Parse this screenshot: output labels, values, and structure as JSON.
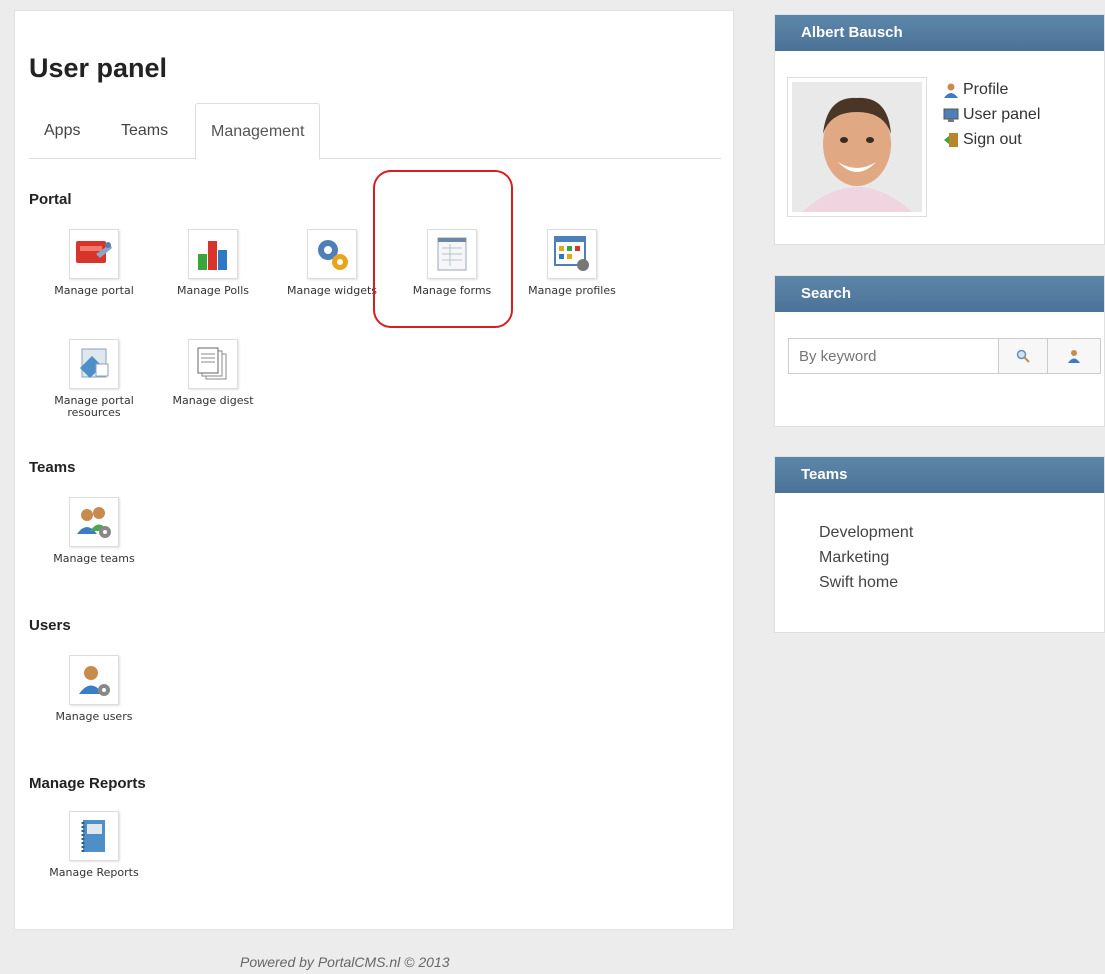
{
  "page": {
    "title": "User panel",
    "footer": "Powered by PortalCMS.nl © 2013"
  },
  "tabs": [
    {
      "label": "Apps",
      "active": false
    },
    {
      "label": "Teams",
      "active": false
    },
    {
      "label": "Management",
      "active": true
    }
  ],
  "sections": {
    "portal": {
      "title": "Portal",
      "tiles": [
        {
          "label": "Manage portal",
          "icon": "portal-tools-icon"
        },
        {
          "label": "Manage Polls",
          "icon": "bar-chart-icon"
        },
        {
          "label": "Manage widgets",
          "icon": "gear-widgets-icon"
        },
        {
          "label": "Manage forms",
          "icon": "form-icon"
        },
        {
          "label": "Manage profiles",
          "icon": "profile-grid-icon"
        },
        {
          "label": "Manage portal resources",
          "icon": "resources-icon"
        },
        {
          "label": "Manage digest",
          "icon": "digest-icon"
        }
      ]
    },
    "teams": {
      "title": "Teams",
      "tiles": [
        {
          "label": "Manage teams",
          "icon": "team-gear-icon"
        }
      ]
    },
    "users": {
      "title": "Users",
      "tiles": [
        {
          "label": "Manage users",
          "icon": "user-gear-icon"
        }
      ]
    },
    "reports": {
      "title": "Manage Reports",
      "tiles": [
        {
          "label": "Manage Reports",
          "icon": "report-book-icon"
        }
      ]
    }
  },
  "profile": {
    "name": "Albert Bausch",
    "links": [
      {
        "label": "Profile",
        "icon": "user-icon"
      },
      {
        "label": "User panel",
        "icon": "monitor-icon"
      },
      {
        "label": "Sign out",
        "icon": "door-exit-icon"
      }
    ]
  },
  "search": {
    "title": "Search",
    "placeholder": "By keyword"
  },
  "teams_box": {
    "title": "Teams",
    "items": [
      "Development",
      "Marketing",
      "Swift home"
    ]
  },
  "colors": {
    "header_blue": "#4f7699",
    "highlight_red": "#d62020"
  }
}
